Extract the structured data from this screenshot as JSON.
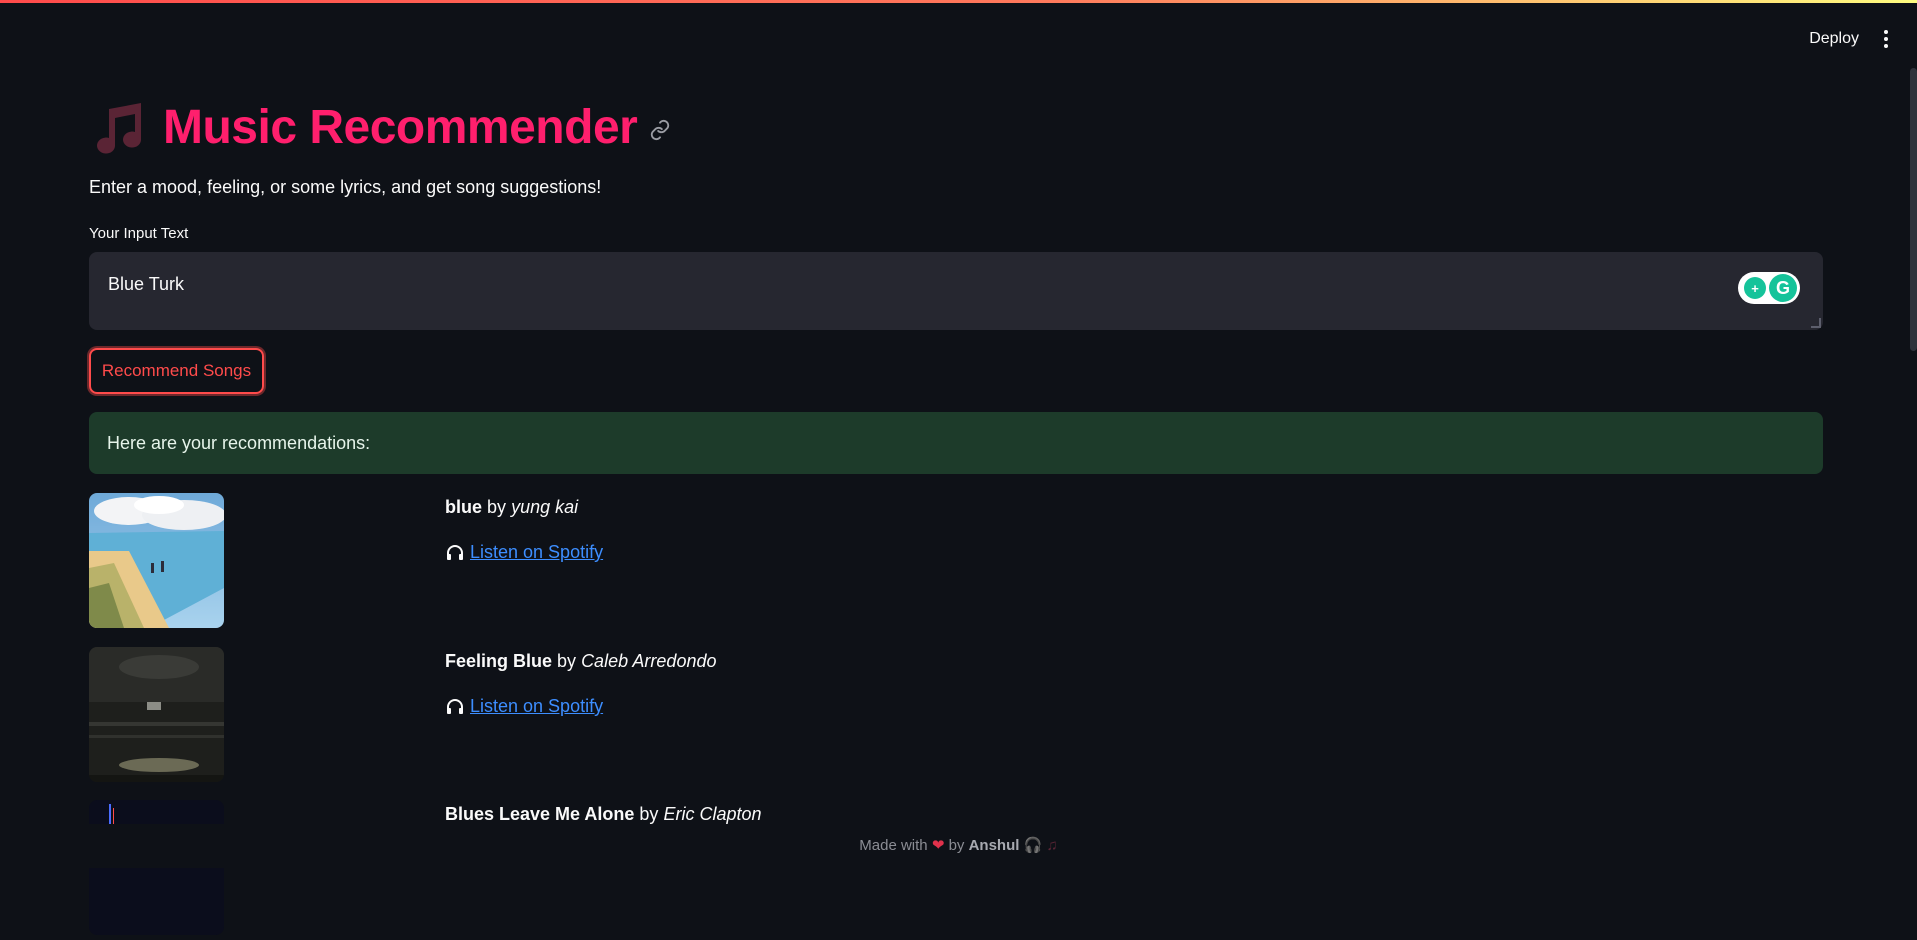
{
  "toolbar": {
    "deploy_label": "Deploy"
  },
  "header": {
    "title": "Music Recommender"
  },
  "intro": {
    "subtitle": "Enter a mood, feeling, or some lyrics, and get song suggestions!"
  },
  "input": {
    "label": "Your Input Text",
    "value": "Blue Turk"
  },
  "actions": {
    "recommend_label": "Recommend Songs"
  },
  "results": {
    "banner": "Here are your recommendations:",
    "songs": [
      {
        "title": "blue",
        "by": "by",
        "artist": "yung kai",
        "link_label": "Listen on Spotify"
      },
      {
        "title": "Feeling Blue",
        "by": "by",
        "artist": "Caleb Arredondo",
        "link_label": "Listen on Spotify"
      },
      {
        "title": "Blues Leave Me Alone",
        "by": "by",
        "artist": "Eric Clapton"
      }
    ]
  },
  "footer": {
    "prefix": "Made with",
    "by": "by",
    "author": "Anshul"
  },
  "colors": {
    "accent": "#ff1f6d",
    "button": "#ff4b4b",
    "link": "#3d8eff",
    "success_bg": "#1d3b2a",
    "background": "#0e1117"
  }
}
